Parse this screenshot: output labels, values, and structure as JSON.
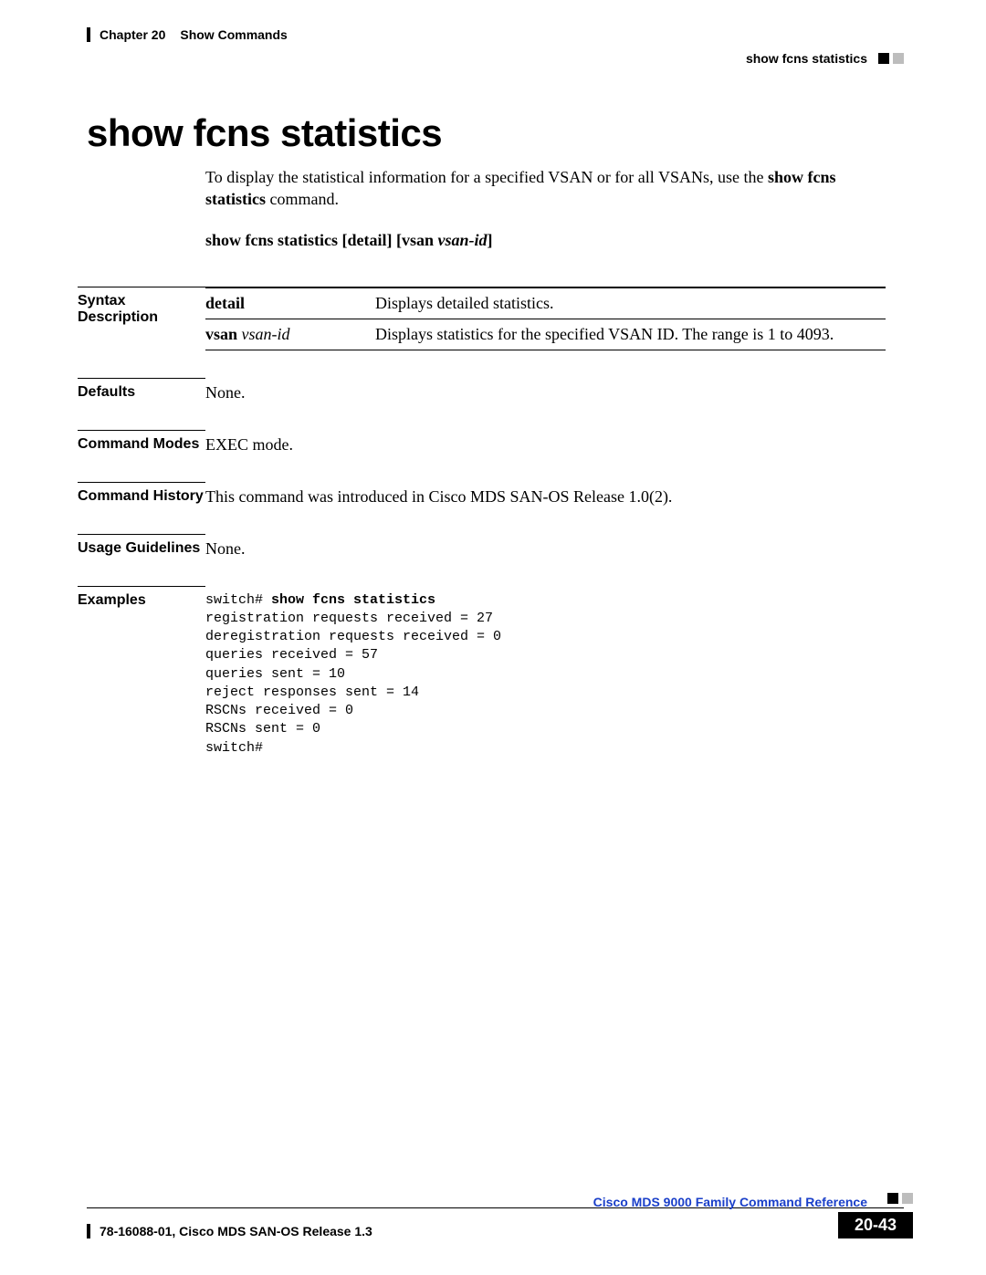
{
  "header": {
    "chapter": "Chapter 20",
    "section_title": "Show Commands",
    "breadcrumb_cmd": "show fcns statistics"
  },
  "title": "show fcns statistics",
  "intro": {
    "pre": "To display the statistical information for a specified VSAN or for all VSANs, use the ",
    "cmd_bold": "show fcns statistics",
    "post": " command."
  },
  "syntax_line": {
    "cmd": "show fcns statistics",
    "opt1_open": " [",
    "opt1": "detail",
    "opt1_close": "] [",
    "opt2_kw": "vsan",
    "opt2_arg": " vsan-id",
    "opt2_close": "]"
  },
  "labels": {
    "syntax": "Syntax Description",
    "defaults": "Defaults",
    "modes": "Command Modes",
    "history": "Command History",
    "usage": "Usage Guidelines",
    "examples": "Examples"
  },
  "syntax_table": {
    "rows": [
      {
        "kw": "detail",
        "arg": "",
        "desc": "Displays detailed statistics."
      },
      {
        "kw": "vsan ",
        "arg": "vsan-id",
        "desc": "Displays statistics for the specified VSAN ID. The range is 1 to 4093."
      }
    ]
  },
  "defaults": "None.",
  "command_modes": "EXEC mode.",
  "command_history": "This command was introduced in Cisco MDS SAN-OS Release 1.0(2).",
  "usage_guidelines": "None.",
  "examples": {
    "prompt_prefix": "switch# ",
    "cmd": "show fcns statistics",
    "lines": [
      "registration requests received = 27",
      "deregistration requests received = 0",
      "queries received = 57",
      "queries sent = 10",
      "reject responses sent = 14",
      "RSCNs received = 0",
      "RSCNs sent = 0",
      "switch#"
    ]
  },
  "footer": {
    "doc_title": "Cisco MDS 9000 Family Command Reference",
    "release": "78-16088-01, Cisco MDS SAN-OS Release 1.3",
    "page_number": "20-43"
  }
}
